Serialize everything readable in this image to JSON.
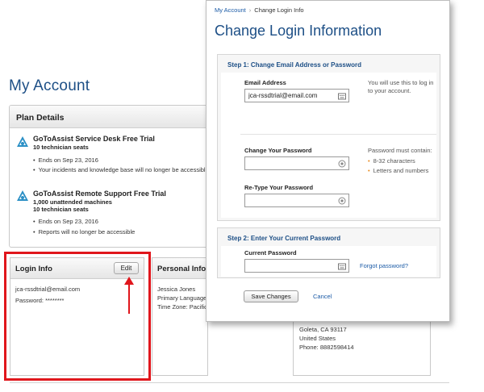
{
  "background_page": {
    "title": "My Account",
    "plan_details": {
      "header": "Plan Details",
      "plans": [
        {
          "name": "GoToAssist Service Desk Free Trial",
          "seats": [
            "10 technician seats"
          ],
          "bullets": [
            "Ends on Sep 23, 2016",
            "Your incidents and knowledge base will no longer be accessible"
          ]
        },
        {
          "name": "GoToAssist Remote Support Free Trial",
          "seats": [
            "1,000 unattended machines",
            "10 technician seats"
          ],
          "bullets": [
            "Ends on Sep 23, 2016",
            "Reports will no longer be accessible"
          ]
        }
      ]
    },
    "login_info": {
      "header": "Login Info",
      "edit_label": "Edit",
      "email": "jca-rssdtrial@email.com",
      "password": "Password: ********"
    },
    "personal_info": {
      "header": "Personal Info",
      "lines": [
        "Jessica Jones",
        "Primary Language:",
        "Time Zone: Pacific"
      ]
    },
    "address": {
      "lines": [
        "Goleta, CA 93117",
        "United States",
        "Phone: 8882598414"
      ]
    }
  },
  "dialog": {
    "breadcrumb": {
      "parent": "My Account",
      "separator": "›",
      "current": "Change Login Info"
    },
    "title": "Change Login Information",
    "step1": {
      "title": "Step 1: Change Email Address or Password",
      "email_label": "Email Address",
      "email_value": "jca-rssdtrial@email.com",
      "email_hint": [
        "You will use this to log in",
        "to your account."
      ],
      "change_password_label": "Change Your Password",
      "change_password_value": "",
      "password_rules_title": "Password must contain:",
      "password_rules": [
        "8-32 characters",
        "Letters and numbers"
      ],
      "retype_password_label": "Re-Type Your Password",
      "retype_password_value": ""
    },
    "step2": {
      "title": "Step 2: Enter Your Current Password",
      "current_password_label": "Current Password",
      "current_password_value": "",
      "forgot_link": "Forgot password?"
    },
    "save_label": "Save Changes",
    "cancel_label": "Cancel"
  },
  "colors": {
    "title_blue": "#1d4f86",
    "link_blue": "#1a5aa6",
    "highlight_red": "#e0161c",
    "bullet_orange": "#e98a1d"
  }
}
